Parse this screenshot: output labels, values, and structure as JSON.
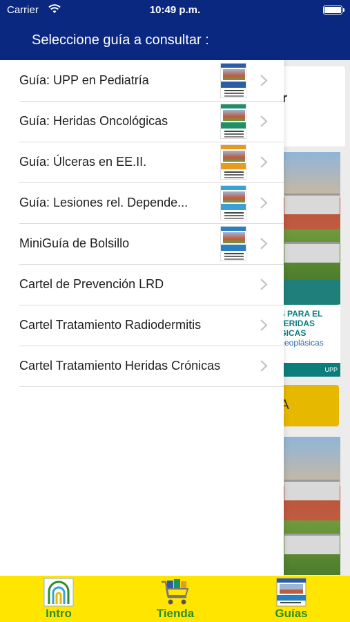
{
  "status_bar": {
    "carrier": "Carrier",
    "time": "10:49 p.m."
  },
  "drawer": {
    "title": "Seleccione guía a consultar :",
    "items": [
      {
        "label": "Guía: UPP en Pediatría",
        "thumb_color": "#2b5ca8",
        "icon": "guide-cover-thumbnail",
        "has_thumb": true
      },
      {
        "label": "Guía: Heridas Oncológicas",
        "thumb_color": "#1f8f6a",
        "icon": "guide-cover-thumbnail",
        "has_thumb": true
      },
      {
        "label": "Guía: Úlceras en EE.II.",
        "thumb_color": "#e79a1c",
        "icon": "guide-cover-thumbnail",
        "has_thumb": true
      },
      {
        "label": "Guía: Lesiones rel. Depende...",
        "thumb_color": "#3aa0d8",
        "icon": "guide-cover-thumbnail",
        "has_thumb": true
      },
      {
        "label": "MiniGuía de Bolsillo",
        "thumb_color": "#2a7fc2",
        "icon": "guide-cover-thumbnail",
        "has_thumb": true
      },
      {
        "label": "Cartel de Prevención LRD",
        "has_thumb": false
      },
      {
        "label": "Cartel Tratamiento Radiodermitis",
        "has_thumb": false
      },
      {
        "label": "Cartel Tratamiento Heridas Crónicas",
        "has_thumb": false
      }
    ]
  },
  "background": {
    "card_title": "ar",
    "poster_lines": [
      "AS PARA EL",
      "HERIDAS",
      "ÓGICAS",
      "s neoplásicas"
    ],
    "poster_logo": "UPP",
    "yellow_button": "ÍA"
  },
  "tabbar": {
    "tabs": [
      {
        "label": "Intro",
        "icon": "arch-logo-icon"
      },
      {
        "label": "Tienda",
        "icon": "shopping-cart-icon"
      },
      {
        "label": "Guías",
        "icon": "guides-book-icon"
      }
    ]
  },
  "colors": {
    "header_bg": "#0a2880",
    "tabbar_bg": "#ffe500",
    "tab_label": "#2a8d2a",
    "accent_yellow": "#e6b800"
  }
}
